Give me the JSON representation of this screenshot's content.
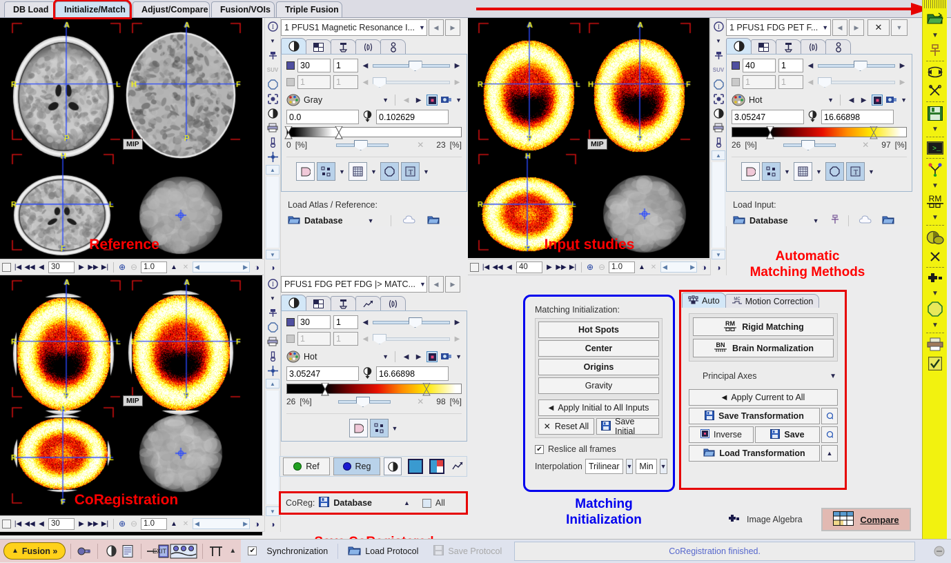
{
  "app": {
    "tabs": [
      {
        "label": "DB Load",
        "selected": false
      },
      {
        "label": "Initialize/Match",
        "selected": true,
        "highlighted": true
      },
      {
        "label": "Adjust/Compare",
        "selected": false
      },
      {
        "label": "Fusion/VOIs",
        "selected": false
      },
      {
        "label": "Triple Fusion",
        "selected": false
      }
    ]
  },
  "annotations": {
    "reference": "Reference",
    "input_studies": "Input studies",
    "coregistration": "CoRegistration",
    "automatic_matching": "Automatic\nMatching Methods",
    "matching_init": "Matching\nInitialization",
    "save_coregistered": "Save CoRegistered"
  },
  "reference_panel": {
    "series": "1 PFUS1 Magnetic Resonance I...",
    "tabs": [
      "contrast-tab",
      "layout-tab",
      "tools-tab",
      "wave-tab",
      "probe-tab"
    ],
    "slice_value": "30",
    "frame_value": "1",
    "slice2_value": "1",
    "frame2_value": "1",
    "lut": "Gray",
    "min_value": "0.0",
    "max_value": "0.102629",
    "pct_min": "0",
    "pct_max": "23",
    "pct_unit": "[%]",
    "load_label": "Load Atlas / Reference:",
    "load_source": "Database",
    "nav": {
      "slice": "30",
      "zoom": "1.0"
    },
    "orientation": {
      "a": "A",
      "p": "P",
      "r": "R",
      "l": "L",
      "h": "H",
      "f": "F"
    },
    "mip": "MIP"
  },
  "input_panel": {
    "series": "1 PFUS1 FDG PET F...",
    "slice_value": "40",
    "frame_value": "1",
    "slice2_value": "1",
    "frame2_value": "1",
    "lut": "Hot",
    "min_value": "3.05247",
    "max_value": "16.66898",
    "pct_min": "26",
    "pct_max": "97",
    "pct_unit": "[%]",
    "load_label": "Load Input:",
    "load_source": "Database",
    "nav": {
      "slice": "40",
      "zoom": "1.0"
    },
    "mip": "MIP"
  },
  "coreg_panel": {
    "series": "PFUS1 FDG PET FDG |> MATC...",
    "slice_value": "30",
    "frame_value": "1",
    "slice2_value": "1",
    "frame2_value": "1",
    "lut": "Hot",
    "min_value": "3.05247",
    "max_value": "16.66898",
    "pct_min": "26",
    "pct_max": "98",
    "pct_unit": "[%]",
    "ref_btn": "Ref",
    "reg_btn": "Reg",
    "coreg_label": "CoReg:",
    "coreg_source": "Database",
    "coreg_all": "All",
    "nav": {
      "slice": "30",
      "zoom": "1.0"
    },
    "mip": "MIP"
  },
  "matching_init": {
    "title": "Matching Initialization:",
    "buttons": [
      "Hot Spots",
      "Center",
      "Origins",
      "Gravity"
    ],
    "apply_initial": "Apply Initial to All Inputs",
    "reset_all": "Reset All",
    "save_initial": "Save Initial",
    "reslice_label": "Reslice all frames",
    "reslice_checked": true,
    "interpolation_label": "Interpolation",
    "interpolation_value": "Trilinear",
    "interpolation_mode": "Min"
  },
  "auto_matching": {
    "tabs": [
      {
        "label": "Auto",
        "icon": "auto-icon",
        "selected": true
      },
      {
        "label": "Motion Correction",
        "icon": "mc-icon",
        "selected": false
      }
    ],
    "rigid_matching": "Rigid Matching",
    "rigid_icon": "RM",
    "brain_normalization": "Brain Normalization",
    "brain_icon": "BN",
    "method": "Principal Axes",
    "apply_current": "Apply Current to All",
    "save_transformation": "Save Transformation",
    "inverse": "Inverse",
    "save": "Save",
    "load_transformation": "Load Transformation"
  },
  "footer_right": {
    "image_algebra": "Image Algebra",
    "compare": "Compare"
  },
  "bottom_bar": {
    "fusion": "Fusion »",
    "synchronization": "Synchronization",
    "sync_checked": true,
    "load_protocol": "Load Protocol",
    "save_protocol": "Save Protocol",
    "status": "CoRegistration finished."
  },
  "colors": {
    "accent_red": "#e60000",
    "accent_blue": "#0000ee",
    "rail_yellow": "#f2f20f",
    "selected_tab": "#cfe2f3",
    "compare_bg": "#e2b9b2"
  }
}
